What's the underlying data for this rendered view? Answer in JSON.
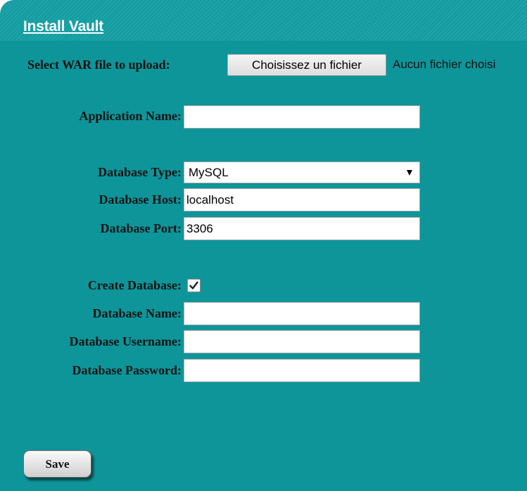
{
  "header": {
    "title": "Install Vault"
  },
  "form": {
    "war_file": {
      "label": "Select WAR file to upload:",
      "button_label": "Choisissez un fichier",
      "status": "Aucun fichier choisi"
    },
    "application_name": {
      "label": "Application Name:",
      "value": ""
    },
    "database_type": {
      "label": "Database Type:",
      "selected": "MySQL"
    },
    "database_host": {
      "label": "Database Host:",
      "value": "localhost"
    },
    "database_port": {
      "label": "Database Port:",
      "value": "3306"
    },
    "create_database": {
      "label": "Create Database:",
      "checked": true
    },
    "database_name": {
      "label": "Database Name:",
      "value": ""
    },
    "database_username": {
      "label": "Database Username:",
      "value": ""
    },
    "database_password": {
      "label": "Database Password:",
      "value": ""
    },
    "save_label": "Save"
  },
  "colors": {
    "panel_background": "#0e9599",
    "title_text": "#ffffff"
  }
}
